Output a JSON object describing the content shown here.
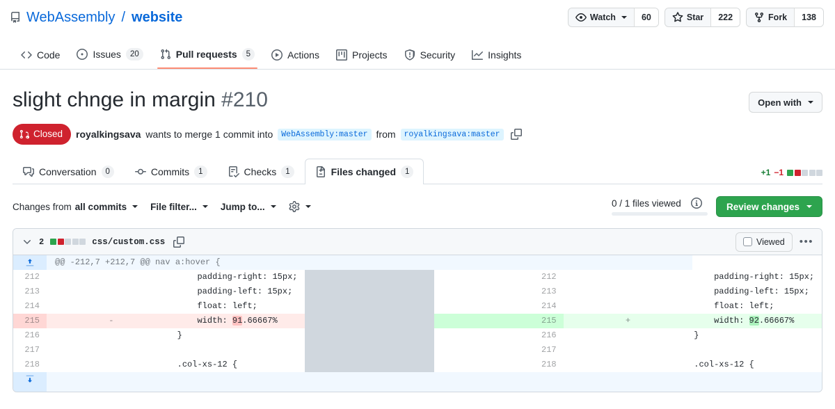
{
  "repo": {
    "icon": "repo-icon",
    "owner": "WebAssembly",
    "separator": "/",
    "name": "website",
    "actions": [
      {
        "label": "Watch",
        "count": "60",
        "icon": "eye-icon",
        "has_caret": true
      },
      {
        "label": "Star",
        "count": "222",
        "icon": "star-icon",
        "has_caret": false
      },
      {
        "label": "Fork",
        "count": "138",
        "icon": "fork-icon",
        "has_caret": false
      }
    ]
  },
  "nav": {
    "items": [
      {
        "label": "Code",
        "icon": "code-icon",
        "count": "",
        "active": false
      },
      {
        "label": "Issues",
        "icon": "issue-opened-icon",
        "count": "20",
        "active": false
      },
      {
        "label": "Pull requests",
        "icon": "git-pull-request-icon",
        "count": "5",
        "active": true
      },
      {
        "label": "Actions",
        "icon": "play-icon",
        "count": "",
        "active": false
      },
      {
        "label": "Projects",
        "icon": "project-icon",
        "count": "",
        "active": false
      },
      {
        "label": "Security",
        "icon": "shield-icon",
        "count": "",
        "active": false
      },
      {
        "label": "Insights",
        "icon": "graph-icon",
        "count": "",
        "active": false
      }
    ]
  },
  "pull_request": {
    "title": "slight chnge in margin",
    "number": "#210",
    "open_with_label": "Open with",
    "state": "Closed",
    "author": "royalkingsava",
    "merge_text_1": "wants to merge 1 commit into",
    "base_branch": "WebAssembly:master",
    "merge_text_2": "from",
    "head_branch": "royalkingsava:master",
    "tabs": [
      {
        "label": "Conversation",
        "icon": "comment-icon",
        "count": "0",
        "active": false
      },
      {
        "label": "Commits",
        "icon": "commit-icon",
        "count": "1",
        "active": false
      },
      {
        "label": "Checks",
        "icon": "checklist-icon",
        "count": "1",
        "active": false
      },
      {
        "label": "Files changed",
        "icon": "file-diff-icon",
        "count": "1",
        "active": true
      }
    ],
    "diffstat": {
      "additions": "+1",
      "deletions": "−1",
      "blocks": [
        "g",
        "r",
        "n",
        "n",
        "n"
      ]
    }
  },
  "toolbar": {
    "changes_from_prefix": "Changes from",
    "changes_from_value": "all commits",
    "file_filter": "File filter...",
    "jump_to": "Jump to...",
    "settings_icon": "gear-icon",
    "files_viewed": "0 / 1 files viewed",
    "info_icon": "info-icon",
    "review_changes": "Review changes"
  },
  "file": {
    "changes_count": "2",
    "blocks": [
      "g",
      "r",
      "n",
      "n",
      "n"
    ],
    "path": "css/custom.css",
    "copy_icon": "copy-icon",
    "viewed_label": "Viewed",
    "menu_icon": "kebab-menu-icon",
    "hunk_header": "@@ -212,7 +212,7 @@ nav a:hover {",
    "expand_up_icon": "expand-up-icon",
    "expand_down_icon": "expand-down-icon",
    "left_lines": [
      {
        "num": "212",
        "marker": "",
        "code": "    padding-right: 15px;",
        "type": "ctx"
      },
      {
        "num": "213",
        "marker": "",
        "code": "    padding-left: 15px;",
        "type": "ctx"
      },
      {
        "num": "214",
        "marker": "",
        "code": "    float: left;",
        "type": "ctx"
      },
      {
        "num": "215",
        "marker": "-",
        "code": "    width: 91.66667%",
        "type": "del",
        "highlight": "91"
      },
      {
        "num": "216",
        "marker": "",
        "code": "}",
        "type": "ctx"
      },
      {
        "num": "217",
        "marker": "",
        "code": "",
        "type": "ctx"
      },
      {
        "num": "218",
        "marker": "",
        "code": ".col-xs-12 {",
        "type": "ctx"
      }
    ],
    "right_lines": [
      {
        "num": "212",
        "marker": "",
        "code": "    padding-right: 15px;",
        "type": "ctx"
      },
      {
        "num": "213",
        "marker": "",
        "code": "    padding-left: 15px;",
        "type": "ctx"
      },
      {
        "num": "214",
        "marker": "",
        "code": "    float: left;",
        "type": "ctx"
      },
      {
        "num": "215",
        "marker": "+",
        "code": "    width: 92.66667%",
        "type": "add",
        "highlight": "92"
      },
      {
        "num": "216",
        "marker": "",
        "code": "}",
        "type": "ctx"
      },
      {
        "num": "217",
        "marker": "",
        "code": "",
        "type": "ctx"
      },
      {
        "num": "218",
        "marker": "",
        "code": ".col-xs-12 {",
        "type": "ctx"
      }
    ]
  },
  "colors": {
    "link": "#0969da",
    "closed": "#cf222e",
    "green": "#2da44e",
    "active_tab_underline": "#fd8c73"
  }
}
